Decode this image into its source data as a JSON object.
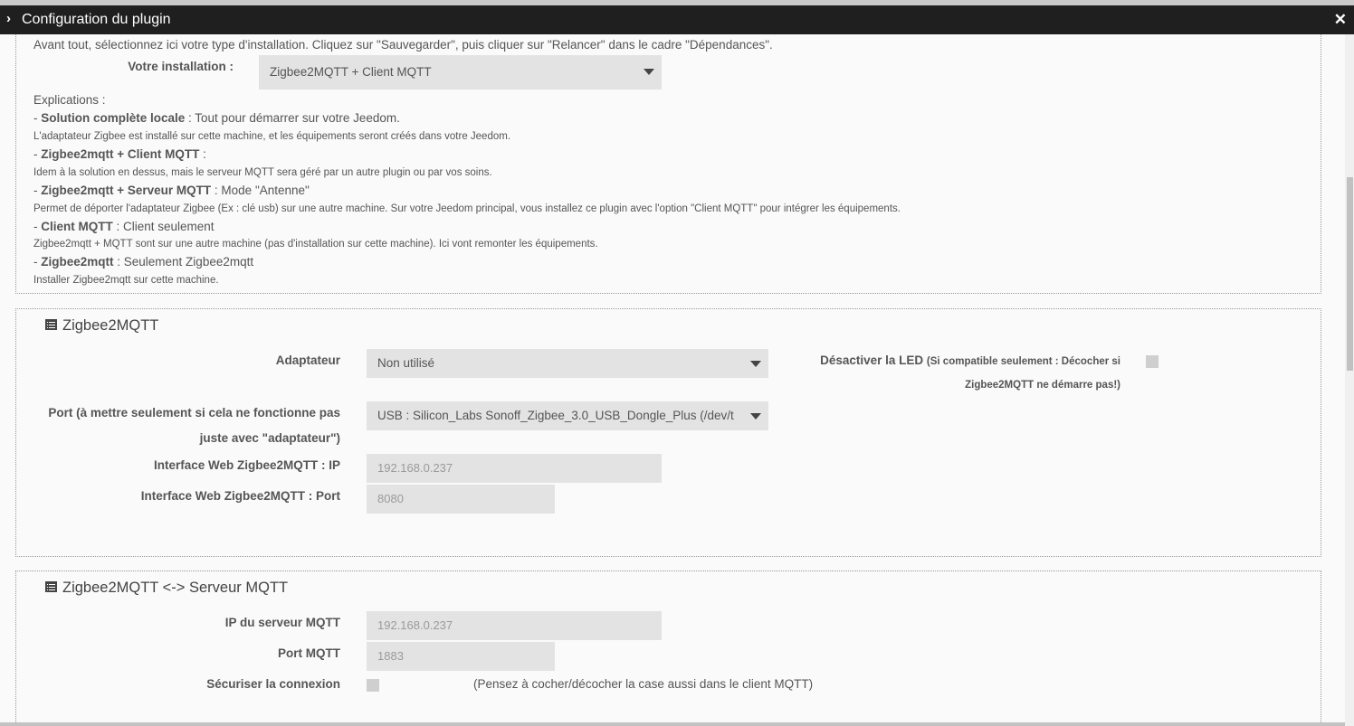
{
  "window": {
    "title": "Configuration du plugin",
    "close_glyph": "✕",
    "chevron_glyph": "›"
  },
  "intro": {
    "text": "Avant tout, sélectionnez ici votre type d'installation. Cliquez sur \"Sauvegarder\", puis cliquer sur \"Relancer\" dans le cadre \"Dépendances\".",
    "installation_label": "Votre installation :",
    "installation_value": "Zigbee2MQTT + Client MQTT"
  },
  "explanations": {
    "title": "Explications :",
    "items": [
      {
        "name": "Solution complète locale",
        "suffix": " : Tout pour démarrer sur votre Jeedom.",
        "desc": "L'adaptateur Zigbee est installé sur cette machine, et les équipements seront créés dans votre Jeedom."
      },
      {
        "name": "Zigbee2mqtt + Client MQTT",
        "suffix": " :",
        "desc": "Idem à la solution en dessus, mais le serveur MQTT sera géré par un autre plugin ou par vos soins."
      },
      {
        "name": "Zigbee2mqtt + Serveur MQTT",
        "suffix": " : Mode \"Antenne\"",
        "desc": "Permet de déporter l'adaptateur Zigbee (Ex : clé usb) sur une autre machine. Sur votre Jeedom principal, vous installez ce plugin avec l'option \"Client MQTT\" pour intégrer les équipements."
      },
      {
        "name": "Client MQTT",
        "suffix": " : Client seulement",
        "desc": "Zigbee2mqtt + MQTT sont sur une autre machine (pas d'installation sur cette machine). Ici vont remonter les équipements."
      },
      {
        "name": "Zigbee2mqtt",
        "suffix": " : Seulement Zigbee2mqtt",
        "desc": "Installer Zigbee2mqtt sur cette machine."
      }
    ]
  },
  "zigbee": {
    "title": "Zigbee2MQTT",
    "icon": "list-alt-icon",
    "adapter_label": "Adaptateur",
    "adapter_value": "Non utilisé",
    "led_label_bold": "Désactiver la LED",
    "led_label_note_1": "(Si compatible seulement : Décocher si",
    "led_label_note_2": "Zigbee2MQTT ne démarre pas!)",
    "port_label_1": "Port (à mettre seulement si cela ne fonctionne pas",
    "port_label_2": "juste avec \"adaptateur\")",
    "port_value": "USB : Silicon_Labs Sonoff_Zigbee_3.0_USB_Dongle_Plus (/dev/t",
    "web_ip_label": "Interface Web Zigbee2MQTT : IP",
    "web_ip_placeholder": "192.168.0.237",
    "web_port_label": "Interface Web Zigbee2MQTT : Port",
    "web_port_placeholder": "8080"
  },
  "mqtt": {
    "title": "Zigbee2MQTT <-> Serveur MQTT",
    "icon": "list-alt-icon",
    "ip_label": "IP du serveur MQTT",
    "ip_placeholder": "192.168.0.237",
    "port_label": "Port MQTT",
    "port_placeholder": "1883",
    "secure_label": "Sécuriser la connexion",
    "secure_note": "(Pensez à cocher/décocher la case aussi dans le client MQTT)"
  }
}
